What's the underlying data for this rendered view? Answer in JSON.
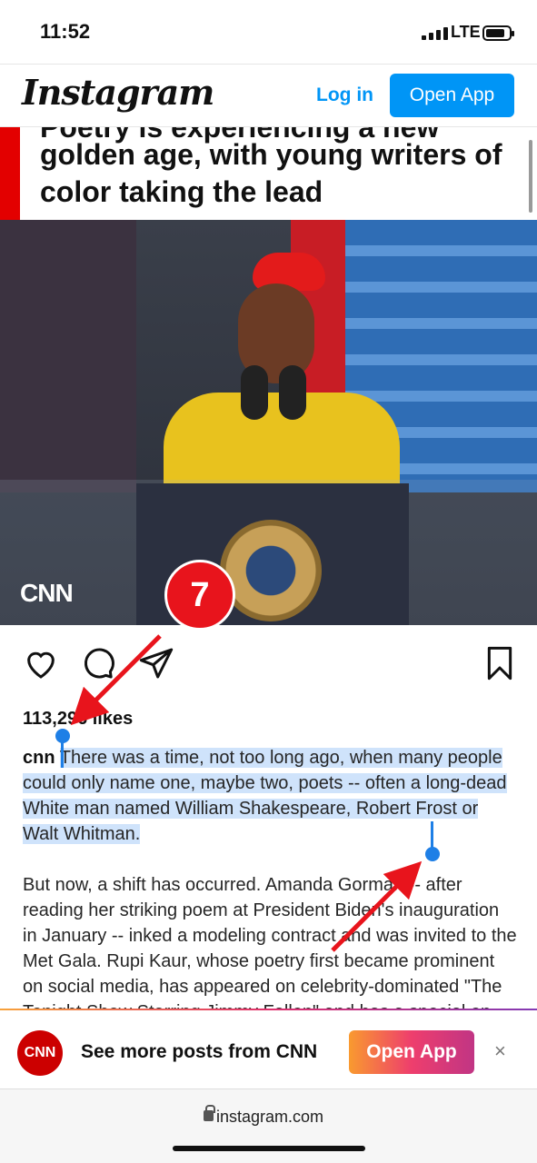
{
  "status": {
    "time": "11:52",
    "network": "LTE"
  },
  "header": {
    "logo": "Instagram",
    "login": "Log in",
    "open_app": "Open App"
  },
  "post": {
    "headline_cut": "Poetry is experiencing a new",
    "headline": "golden age, with young writers of color taking the lead",
    "image_brand": "CNN",
    "likes": "113,296 likes",
    "username": "cnn",
    "caption_selected": "There was a time, not too long ago, when many people could only name one, maybe two, poets -- often a long-dead White man named William Shakespeare, Robert Frost or Walt Whitman.",
    "caption_p2": "But now, a shift has occurred. Amanda Gorman -- after reading her striking poem at President Biden's inauguration in January -- inked a modeling contract and was invited to the Met Gala. Rupi Kaur, whose poetry first became prominent on social media, has appeared on celebrity-dominated \"The Tonight Show Starring Jimmy Fallon\" and has a special on Amazon Prime."
  },
  "annotation": {
    "step": "7"
  },
  "promo": {
    "avatar": "CNN",
    "text": "See more posts from CNN",
    "button": "Open App",
    "close": "×"
  },
  "browser": {
    "url": "instagram.com"
  },
  "colors": {
    "accent": "#0095f6",
    "badge": "#e8141c",
    "selection": "#cfe3fb"
  }
}
